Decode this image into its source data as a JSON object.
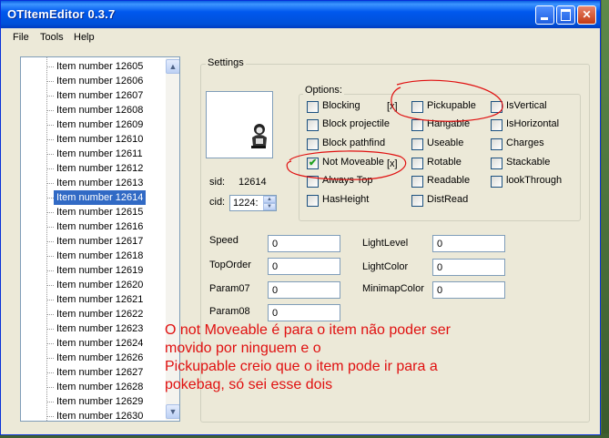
{
  "window": {
    "title": "OTItemEditor 0.3.7"
  },
  "title_buttons": {
    "minimize": "minimize-icon",
    "maximize": "maximize-icon",
    "close": "close-icon",
    "close_glyph": "✕"
  },
  "menu": {
    "file": "File",
    "tools": "Tools",
    "help": "Help"
  },
  "item_list": {
    "items": [
      "Item number 12605",
      "Item number 12606",
      "Item number 12607",
      "Item number 12608",
      "Item number 12609",
      "Item number 12610",
      "Item number 12611",
      "Item number 12612",
      "Item number 12613",
      "Item number 12614",
      "Item number 12615",
      "Item number 12616",
      "Item number 12617",
      "Item number 12618",
      "Item number 12619",
      "Item number 12620",
      "Item number 12621",
      "Item number 12622",
      "Item number 12623",
      "Item number 12624",
      "Item number 12626",
      "Item number 12627",
      "Item number 12628",
      "Item number 12629",
      "Item number 12630"
    ],
    "selected_index": 9,
    "scroll_up_glyph": "▲",
    "scroll_down_glyph": "▼"
  },
  "settings": {
    "group_label": "Settings",
    "sid_label": "sid:",
    "sid_value": "12614",
    "cid_label": "cid:",
    "cid_value": "1224:",
    "spin_up": "▲",
    "spin_down": "▼"
  },
  "options": {
    "group_label": "Options:",
    "check_glyph": "✔",
    "col1": [
      {
        "label": "Blocking",
        "checked": false
      },
      {
        "label": "Block projectile",
        "checked": false
      },
      {
        "label": "Block pathfind",
        "checked": false
      },
      {
        "label": "Not Moveable",
        "checked": true
      },
      {
        "label": "Always Top",
        "checked": false
      },
      {
        "label": "HasHeight",
        "checked": false
      }
    ],
    "col2": [
      {
        "label": "Pickupable",
        "checked": false
      },
      {
        "label": "Hangable",
        "checked": false
      },
      {
        "label": "Useable",
        "checked": false
      },
      {
        "label": "Rotable",
        "checked": false
      },
      {
        "label": "Readable",
        "checked": false
      },
      {
        "label": "DistRead",
        "checked": false
      }
    ],
    "col3": [
      {
        "label": "IsVertical",
        "checked": false
      },
      {
        "label": "IsHorizontal",
        "checked": false
      },
      {
        "label": "Charges",
        "checked": false
      },
      {
        "label": "Stackable",
        "checked": false
      },
      {
        "label": "lookThrough",
        "checked": false
      }
    ],
    "pickupable_mark": "[x]",
    "not_moveable_mark": "[x]"
  },
  "fields": {
    "speed": {
      "label": "Speed",
      "value": "0"
    },
    "top_order": {
      "label": "TopOrder",
      "value": "0"
    },
    "param07": {
      "label": "Param07",
      "value": "0"
    },
    "param08": {
      "label": "Param08",
      "value": "0"
    },
    "light_level": {
      "label": "LightLevel",
      "value": "0"
    },
    "light_color": {
      "label": "LightColor",
      "value": "0"
    },
    "minimap_color": {
      "label": "MinimapColor",
      "value": "0"
    }
  },
  "annotation": {
    "lines": [
      "O not Moveable é para o item não poder ser",
      "movido por ninguem  e o",
      "Pickupable creio que o item pode ir para  a",
      "pokebag, só sei esse dois"
    ],
    "color": "#e01010"
  }
}
